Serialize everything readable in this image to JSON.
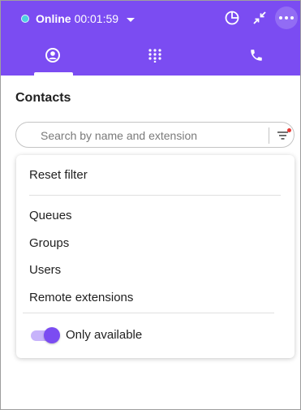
{
  "colors": {
    "accent": "#7b4cf2",
    "online": "#4dd0e1",
    "filter_dot": "#e53935"
  },
  "header": {
    "status_label": "Online",
    "timer": "00:01:59",
    "actions": [
      "pie-chart-icon",
      "collapse-icon",
      "more-icon"
    ],
    "tabs": [
      {
        "icon": "contacts-icon",
        "selected": true
      },
      {
        "icon": "dialpad-icon",
        "selected": false
      },
      {
        "icon": "phone-icon",
        "selected": false
      }
    ]
  },
  "main": {
    "title": "Contacts",
    "search": {
      "placeholder": "Search by name and extension",
      "value": ""
    }
  },
  "filter_menu": {
    "reset": "Reset filter",
    "items": [
      "Queues",
      "Groups",
      "Users",
      "Remote extensions"
    ],
    "toggle": {
      "label": "Only available",
      "on": true
    }
  }
}
